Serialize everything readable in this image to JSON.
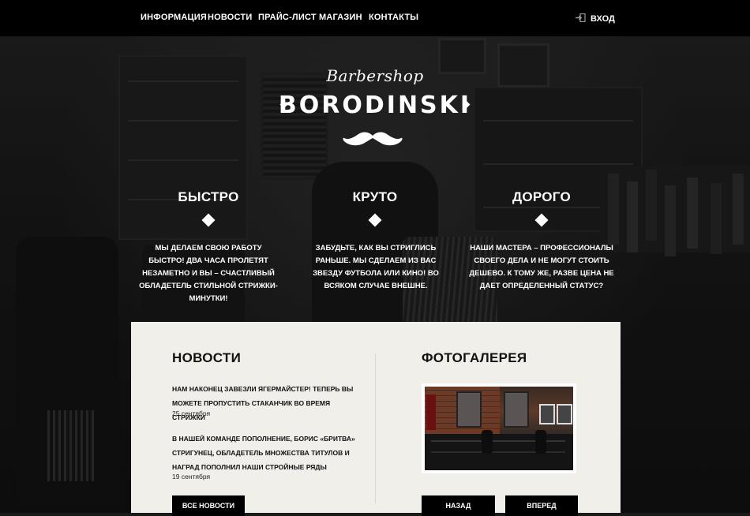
{
  "nav": {
    "items": [
      "ИНФОРМАЦИЯ",
      "НОВОСТИ",
      "ПРАЙС-ЛИСТ",
      "МАГАЗИН",
      "КОНТАКТЫ"
    ],
    "login_label": "ВХОД",
    "login_icon": "login-icon"
  },
  "logo": {
    "script": "Barbershop",
    "name": "BORODINSKI",
    "mustache_icon": "mustache-icon"
  },
  "features": [
    {
      "title": "БЫСТРО",
      "text": "МЫ ДЕЛАЕМ СВОЮ РАБОТУ БЫСТРО! ДВА ЧАСА ПРОЛЕТЯТ НЕЗАМЕТНО И ВЫ – СЧАСТЛИВЫЙ ОБЛАДЕТЕЛЬ СТИЛЬНОЙ СТРИЖКИ-МИНУТКИ!"
    },
    {
      "title": "КРУТО",
      "text": "ЗАБУДЬТЕ, КАК ВЫ СТРИГЛИСЬ РАНЬШЕ. МЫ СДЕЛАЕМ ИЗ ВАС ЗВЕЗДУ ФУТБОЛА ИЛИ КИНО! ВО ВСЯКОМ СЛУЧАЕ ВНЕШНЕ."
    },
    {
      "title": "ДОРОГО",
      "text": "НАШИ МАСТЕРА – ПРОФЕССИОНАЛЫ СВОЕГО ДЕЛА И НЕ МОГУТ СТОИТЬ ДЕШЕВО. К ТОМУ ЖЕ, РАЗВЕ ЦЕНА НЕ ДАЕТ ОПРЕДЕЛЕННЫЙ СТАТУС?"
    }
  ],
  "news": {
    "title": "НОВОСТИ",
    "items": [
      {
        "title": "НАМ НАКОНЕЦ ЗАВЕЗЛИ ЯГЕРМАЙСТЕР! ТЕПЕРЬ ВЫ МОЖЕТЕ ПРОПУСТИТЬ СТАКАНЧИК ВО ВРЕМЯ СТРИЖКИ",
        "date": "25 сентября"
      },
      {
        "title": "В НАШЕЙ КОМАНДЕ ПОПОЛНЕНИЕ, БОРИС «БРИТВА» СТРИГУНЕЦ, ОБЛАДЕТЕЛЬ МНОЖЕСТВА ТИТУЛОВ И НАГРАД ПОПОЛНИЛ НАШИ СТРОЙНЫЕ РЯДЫ",
        "date": "19 сентября"
      }
    ],
    "all_button": "ВСЕ НОВОСТИ"
  },
  "gallery": {
    "title": "ФОТОГАЛЕРЕЯ",
    "prev_button": "НАЗАД",
    "next_button": "ВПЕРЕД"
  },
  "colors": {
    "nav_bg": "#000000",
    "panel_bg": "#f1efea",
    "button_bg": "#000000",
    "text_light": "#ffffff",
    "text_dark": "#111111"
  }
}
